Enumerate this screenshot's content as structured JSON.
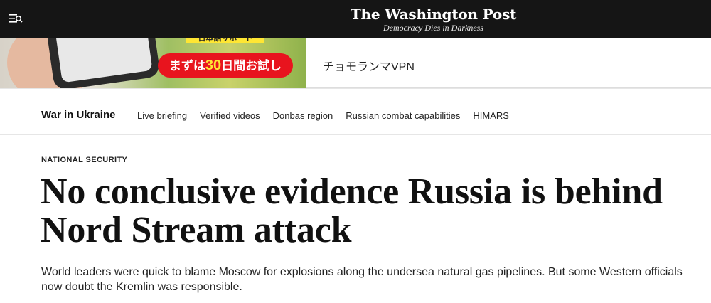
{
  "header": {
    "logo_title": "The Washington Post",
    "logo_tagline": "Democracy Dies in Darkness",
    "menu_icon": "menu-icon"
  },
  "ad": {
    "top_label": "日本語サポート",
    "cta_prefix": "まずは",
    "cta_number": "30",
    "cta_suffix": "日間お試し",
    "advertiser": "チョモランマVPN"
  },
  "nav": {
    "section": "War in Ukraine",
    "links": [
      "Live briefing",
      "Verified videos",
      "Donbas region",
      "Russian combat capabilities",
      "HIMARS"
    ]
  },
  "article": {
    "kicker": "NATIONAL SECURITY",
    "headline": "No conclusive evidence Russia is behind Nord Stream attack",
    "dek": "World leaders were quick to blame Moscow for explosions along the undersea natural gas pipelines. But some Western officials now doubt the Kremlin was responsible."
  }
}
